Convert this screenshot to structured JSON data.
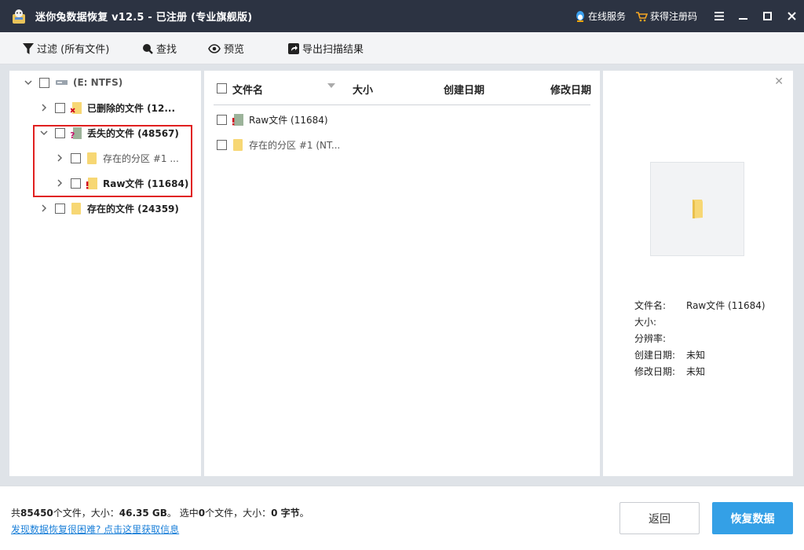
{
  "window": {
    "title": "迷你兔数据恢复 v12.5 - 已注册 (专业旗舰版)",
    "online_service": "在线服务",
    "get_code": "获得注册码"
  },
  "toolbar": {
    "filter": "过滤 (所有文件)",
    "find": "查找",
    "preview": "预览",
    "export": "导出扫描结果"
  },
  "tree": {
    "root": "(E: NTFS)",
    "deleted": "已删除的文件 (12...",
    "lost": "丢失的文件 (48567)",
    "existing_partition": "存在的分区 #1 ...",
    "raw": "Raw文件 (11684)",
    "existing": "存在的文件 (24359)"
  },
  "list": {
    "columns": [
      "文件名",
      "大小",
      "创建日期",
      "修改日期"
    ],
    "rows": [
      {
        "name": "Raw文件 (11684)",
        "icon": "raw-folder-icon"
      },
      {
        "name": "存在的分区 #1 (NT...",
        "icon": "folder-icon"
      }
    ]
  },
  "preview": {
    "labels": {
      "name": "文件名:",
      "size": "大小:",
      "resolution": "分辨率:",
      "created": "创建日期:",
      "modified": "修改日期:"
    },
    "values": {
      "name": "Raw文件 (11684)",
      "size": "",
      "resolution": "",
      "created": "未知",
      "modified": "未知"
    }
  },
  "status": {
    "total_prefix": "共",
    "total_count": "85450",
    "files_size_mid": "个文件，大小：",
    "total_size": "46.35 GB",
    "selected_prefix": "。 选中",
    "selected_count": "0",
    "selected_mid": "个文件，大小：",
    "selected_size": "0 字节",
    "suffix": "。",
    "help_link": "发现数据恢复很困难? 点击这里获取信息"
  },
  "buttons": {
    "back": "返回",
    "recover": "恢复数据"
  },
  "colors": {
    "titlebar": "#2c3342",
    "accent": "#34a0e6",
    "highlight": "#e02020",
    "folder": "#f7d774"
  }
}
